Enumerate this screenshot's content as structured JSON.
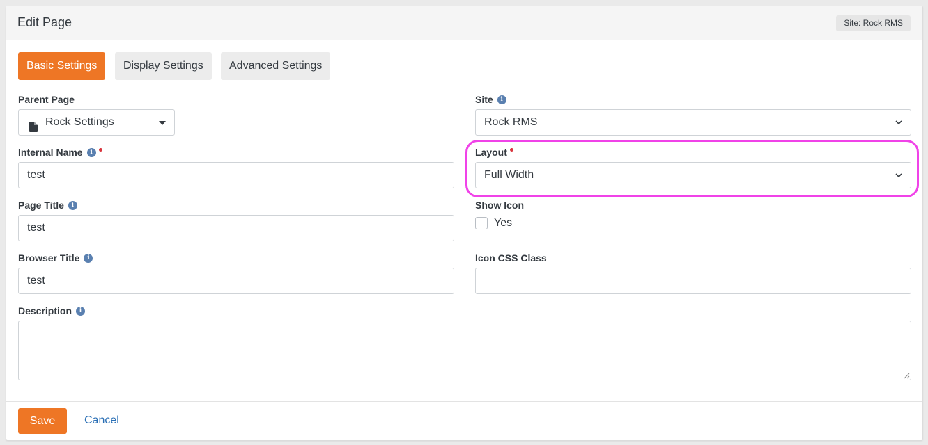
{
  "header": {
    "title": "Edit Page",
    "site_badge": "Site: Rock RMS"
  },
  "tabs": [
    {
      "label": "Basic Settings",
      "active": true
    },
    {
      "label": "Display Settings",
      "active": false
    },
    {
      "label": "Advanced Settings",
      "active": false
    }
  ],
  "fields": {
    "parent_page": {
      "label": "Parent Page",
      "value": "Rock Settings"
    },
    "site": {
      "label": "Site",
      "value": "Rock RMS"
    },
    "internal_name": {
      "label": "Internal Name",
      "value": "test",
      "required": true
    },
    "layout": {
      "label": "Layout",
      "value": "Full Width",
      "required": true
    },
    "page_title": {
      "label": "Page Title",
      "value": "test"
    },
    "show_icon": {
      "label": "Show Icon",
      "option": "Yes",
      "checked": false
    },
    "browser_title": {
      "label": "Browser Title",
      "value": "test"
    },
    "icon_css_class": {
      "label": "Icon CSS Class",
      "value": ""
    },
    "description": {
      "label": "Description",
      "value": ""
    }
  },
  "footer": {
    "save_label": "Save",
    "cancel_label": "Cancel"
  },
  "colors": {
    "accent": "#ee7625",
    "link": "#2a6fb5",
    "info_icon": "#5a80b0",
    "required_dot": "#d9363e",
    "highlight": "#f043e8"
  },
  "icons": {
    "info": "info-icon",
    "file": "file-icon",
    "caret": "caret-down-icon",
    "chevron": "chevron-down-icon"
  }
}
